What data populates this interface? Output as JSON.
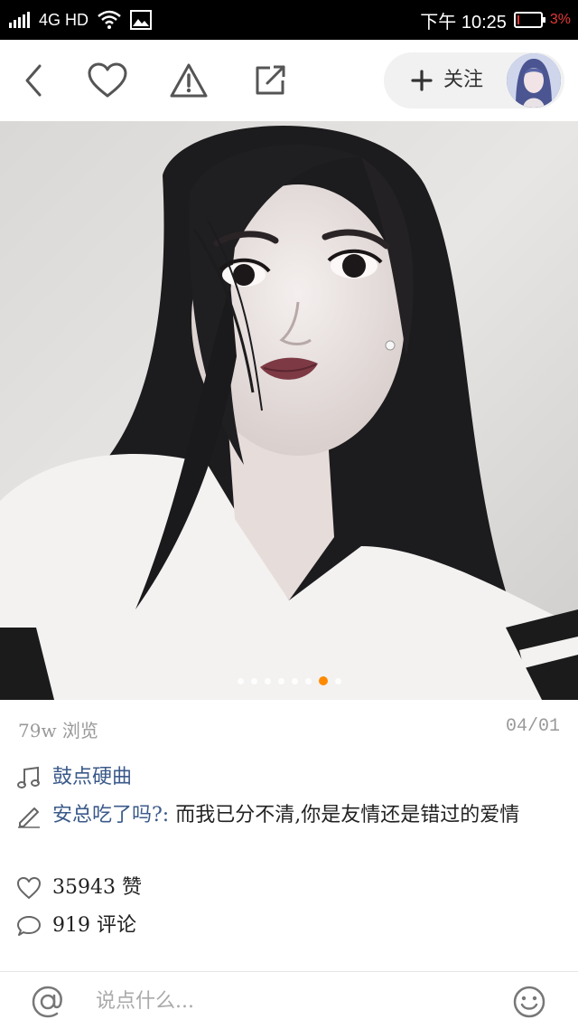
{
  "status_bar": {
    "network": "4G HD",
    "time": "下午 10:25",
    "battery": "3%",
    "battery_level": 0.03
  },
  "top_bar": {
    "back_icon": "chevron-left-icon",
    "like_icon": "heart-icon",
    "report_icon": "warning-icon",
    "share_icon": "share-icon",
    "follow_label": "关注",
    "follow_icon": "plus-icon"
  },
  "photo": {
    "slide_count": 8,
    "active_index": 6
  },
  "meta": {
    "views": "79w 浏览",
    "date": "04/01"
  },
  "music": {
    "icon": "music-note-icon",
    "title": "鼓点硬曲"
  },
  "caption": {
    "icon": "pencil-icon",
    "author": "安总吃了吗?:",
    "text": "而我已分不清,你是友情还是错过的爱情"
  },
  "likes": {
    "icon": "heart-outline-icon",
    "text": "35943 赞"
  },
  "comments": {
    "icon": "comment-bubble-icon",
    "text": "919 评论"
  },
  "comment_bar": {
    "at_icon": "at-icon",
    "placeholder": "说点什么...",
    "emoji_icon": "smiley-icon"
  },
  "colors": {
    "accent": "#ff8a00",
    "link": "#3b5a8a",
    "battery_low": "#e53935"
  }
}
